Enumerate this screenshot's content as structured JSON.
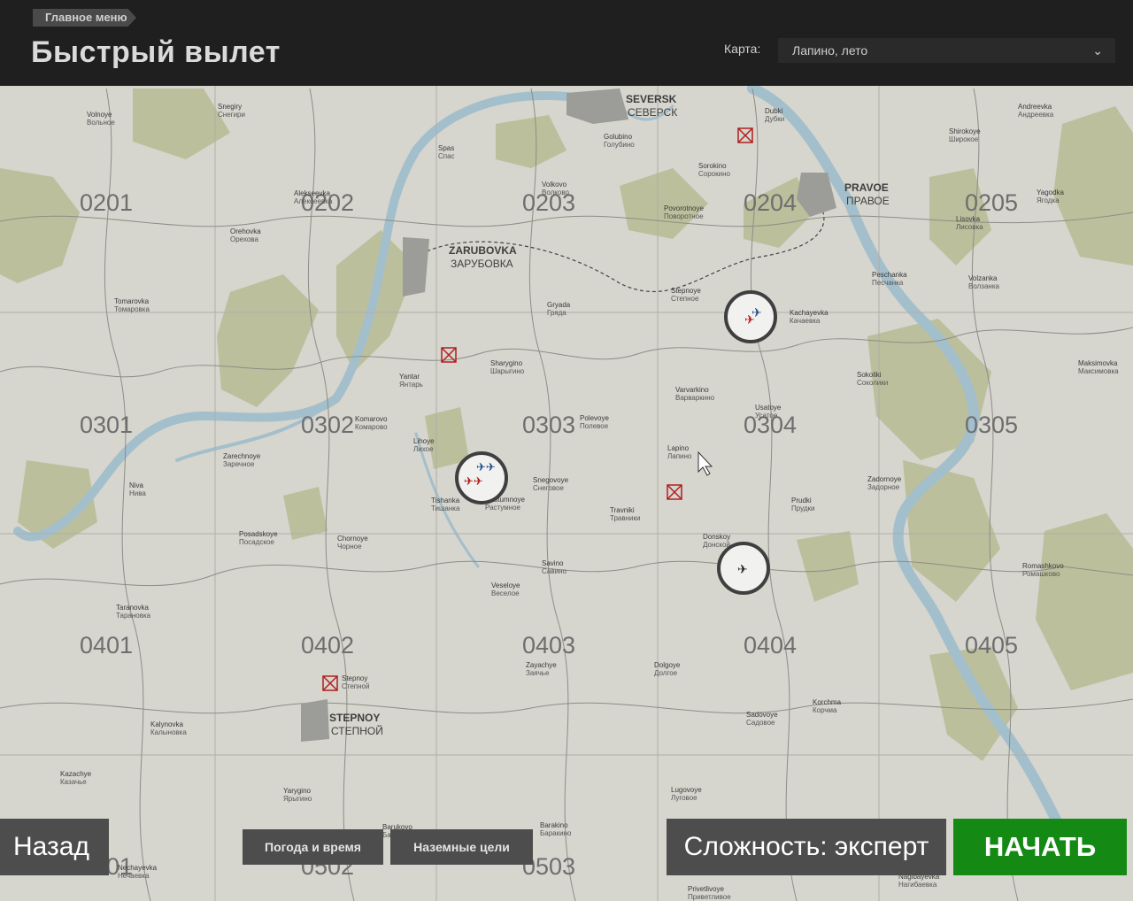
{
  "header": {
    "breadcrumb": "Главное меню",
    "title": "Быстрый вылет",
    "map_label": "Карта:",
    "map_value": "Лапино, лето"
  },
  "grid": {
    "cells": [
      "0201",
      "0202",
      "0203",
      "0204",
      "0205",
      "0301",
      "0302",
      "0303",
      "0304",
      "0305",
      "0401",
      "0402",
      "0403",
      "0404",
      "0405",
      "0501",
      "0502",
      "0503"
    ]
  },
  "towns": [
    {
      "en": "SEVERSK",
      "ru": "СЕВЕРСК"
    },
    {
      "en": "PRAVOE",
      "ru": "ПРАВОЕ"
    },
    {
      "en": "ZARUBOVKA",
      "ru": "ЗАРУБОВКА"
    },
    {
      "en": "STEPNOY",
      "ru": "СТЕПНОЙ"
    }
  ],
  "villages": [
    {
      "en": "Volnoye",
      "ru": "Вольное"
    },
    {
      "en": "Snegiry",
      "ru": "Снегири"
    },
    {
      "en": "Spas",
      "ru": "Спас"
    },
    {
      "en": "Golubino",
      "ru": "Голубино"
    },
    {
      "en": "Dubki",
      "ru": "Дубки"
    },
    {
      "en": "Sorokino",
      "ru": "Сорокино"
    },
    {
      "en": "Shirokoye",
      "ru": "Широкое"
    },
    {
      "en": "Andreevka",
      "ru": "Андреевка"
    },
    {
      "en": "Alekseevka",
      "ru": "Алексеевка"
    },
    {
      "en": "Volkovo",
      "ru": "Волково"
    },
    {
      "en": "Povorotnoye",
      "ru": "Поворотное"
    },
    {
      "en": "Yagodka",
      "ru": "Ягодка"
    },
    {
      "en": "Orehovka",
      "ru": "Орехова"
    },
    {
      "en": "Lisovka",
      "ru": "Лисовка"
    },
    {
      "en": "Peschanka",
      "ru": "Песчанка"
    },
    {
      "en": "Volzanka",
      "ru": "Волзанка"
    },
    {
      "en": "Tomarovka",
      "ru": "Томаровка"
    },
    {
      "en": "Gryada",
      "ru": "Гряда"
    },
    {
      "en": "Stepnoye",
      "ru": "Степное"
    },
    {
      "en": "Kachayevka",
      "ru": "Качаевка"
    },
    {
      "en": "Yantar",
      "ru": "Янтарь"
    },
    {
      "en": "Sharygino",
      "ru": "Шарыгино"
    },
    {
      "en": "Maksimovka",
      "ru": "Максимовка"
    },
    {
      "en": "Sokoliki",
      "ru": "Соколики"
    },
    {
      "en": "Varvarkino",
      "ru": "Варваркино"
    },
    {
      "en": "Usatoye",
      "ru": "Усатое"
    },
    {
      "en": "Komarovo",
      "ru": "Комарово"
    },
    {
      "en": "Polevoye",
      "ru": "Полевое"
    },
    {
      "en": "Lihoye",
      "ru": "Лихое"
    },
    {
      "en": "Lapino",
      "ru": "Лапино"
    },
    {
      "en": "Zarechnoye",
      "ru": "Заречное"
    },
    {
      "en": "Niva",
      "ru": "Нива"
    },
    {
      "en": "Tishanka",
      "ru": "Тишанка"
    },
    {
      "en": "Rastumnoye",
      "ru": "Растумное"
    },
    {
      "en": "Snegovoye",
      "ru": "Снеговое"
    },
    {
      "en": "Zadornoye",
      "ru": "Задорное"
    },
    {
      "en": "Travniki",
      "ru": "Травники"
    },
    {
      "en": "Prudki",
      "ru": "Прудки"
    },
    {
      "en": "Posadskoye",
      "ru": "Посадское"
    },
    {
      "en": "Chornoye",
      "ru": "Чорное"
    },
    {
      "en": "Savino",
      "ru": "Савино"
    },
    {
      "en": "Donskoy",
      "ru": "Донской"
    },
    {
      "en": "Romashkovo",
      "ru": "Ромашково"
    },
    {
      "en": "Taranovka",
      "ru": "Тарановка"
    },
    {
      "en": "Veseloye",
      "ru": "Веселое"
    },
    {
      "en": "Zayachye",
      "ru": "Заячье"
    },
    {
      "en": "Dolgoye",
      "ru": "Долгое"
    },
    {
      "en": "Kalynovka",
      "ru": "Калыновка"
    },
    {
      "en": "Sadovoye",
      "ru": "Садовое"
    },
    {
      "en": "Korchma",
      "ru": "Корчма"
    },
    {
      "en": "Kazachye",
      "ru": "Казачье"
    },
    {
      "en": "Yarygino",
      "ru": "Ярыгино"
    },
    {
      "en": "Lugovoye",
      "ru": "Луговое"
    },
    {
      "en": "Barukovo",
      "ru": "Баруково"
    },
    {
      "en": "Barakino",
      "ru": "Баракино"
    },
    {
      "en": "Nechayevka",
      "ru": "Нечаевка"
    },
    {
      "en": "Privetlivoye",
      "ru": "Приветливое"
    },
    {
      "en": "Nagibayevka",
      "ru": "Нагибаевка"
    },
    {
      "en": "Stepnoy",
      "ru": "Степной"
    }
  ],
  "buttons": {
    "back": "Назад",
    "weather": "Погода и время",
    "ground_targets": "Наземные цели",
    "difficulty": "Сложность: эксперт",
    "start": "НАЧАТЬ"
  }
}
